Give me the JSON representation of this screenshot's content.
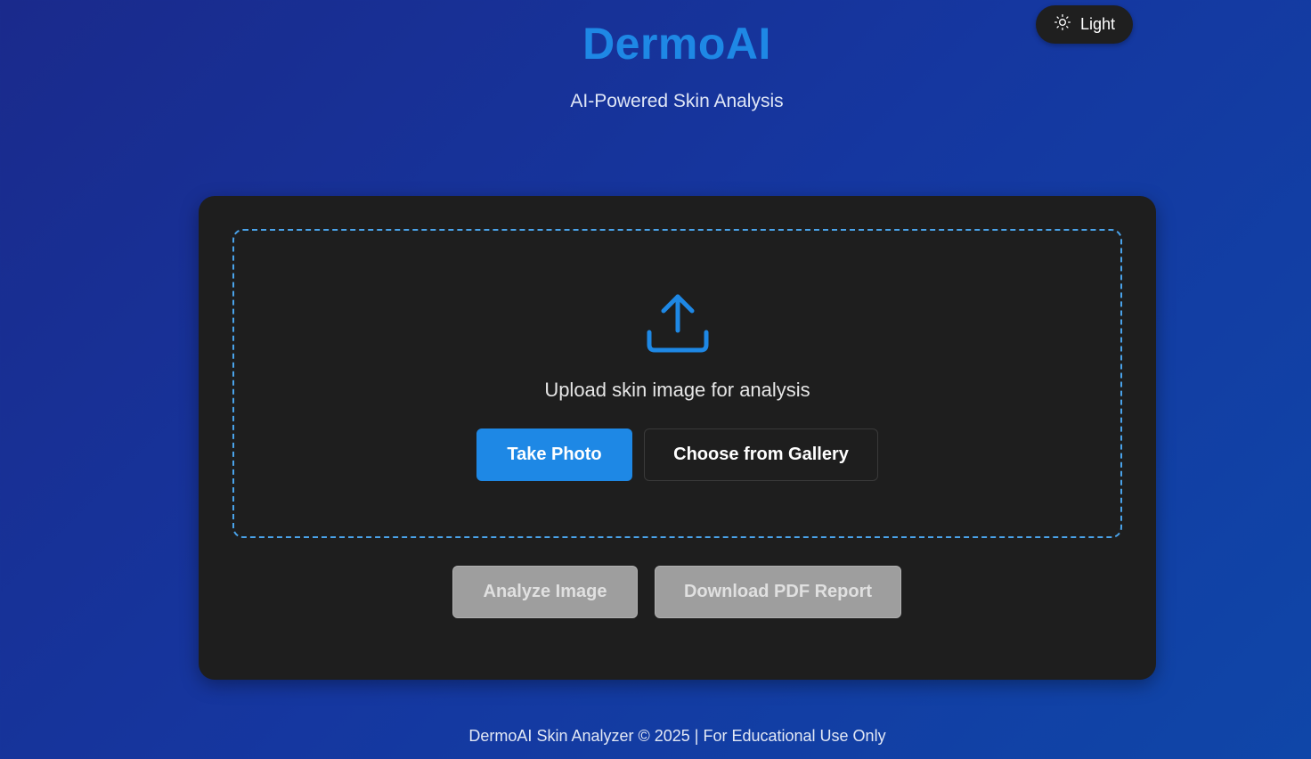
{
  "app": {
    "title": "DermoAI",
    "subtitle": "AI-Powered Skin Analysis"
  },
  "theme_toggle": {
    "icon": "sun-icon",
    "label": "Light"
  },
  "upload": {
    "icon": "upload-icon",
    "prompt": "Upload skin image for analysis",
    "take_photo_label": "Take Photo",
    "gallery_label": "Choose from Gallery"
  },
  "actions": {
    "analyze_label": "Analyze Image",
    "download_label": "Download PDF Report"
  },
  "footer": {
    "text": "DermoAI Skin Analyzer © 2025 | For Educational Use Only"
  },
  "colors": {
    "accent": "#1e88e5",
    "card_bg": "#1e1e1e",
    "disabled_bg": "#9e9e9e",
    "dropzone_border": "#4aa3ea"
  }
}
